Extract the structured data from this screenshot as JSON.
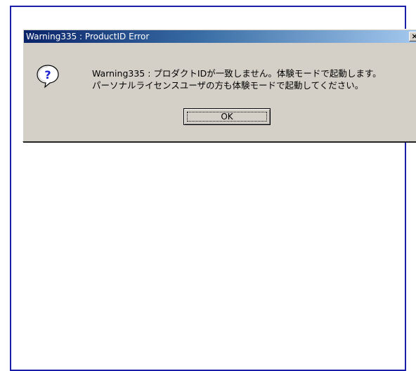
{
  "dialog": {
    "title": "Warning335 : ProductID Error",
    "close_glyph": "×",
    "icon": "question-icon",
    "message_line1": "Warning335 : プロダクトIDが一致しません。体験モードで起動します。",
    "message_line2": "パーソナルライセンスユーザの方も体験モードで起動してください。",
    "ok_label": "OK"
  },
  "colors": {
    "frame_border": "#1a1fa8",
    "dialog_face": "#d4d0c8",
    "titlebar_start": "#0a246a",
    "titlebar_end": "#a6caf0"
  }
}
